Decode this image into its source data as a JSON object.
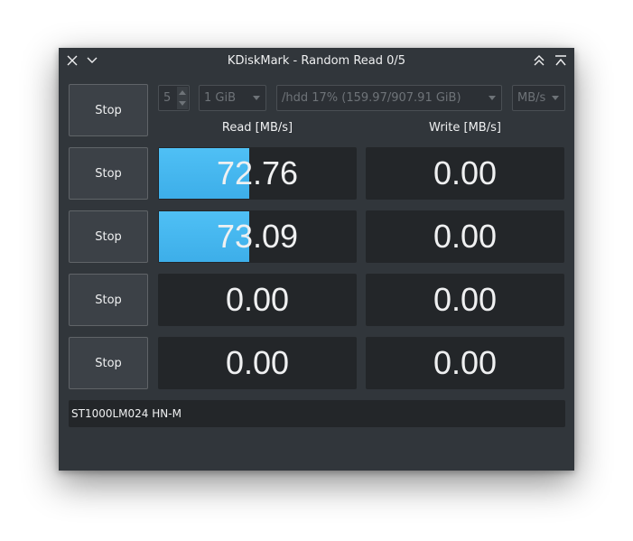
{
  "window": {
    "title": "KDiskMark - Random Read 0/5"
  },
  "titlebar": {
    "close_icon": "close-icon",
    "menu_icon": "chevron-down-icon",
    "keep_above_icon": "double-chevron-up-icon",
    "maximize_icon": "maximize-icon"
  },
  "controls": {
    "loops": "5",
    "file_size": "1 GiB",
    "target": "/hdd 17% (159.97/907.91 GiB)",
    "unit": "MB/s"
  },
  "headers": {
    "read": "Read [MB/s]",
    "write": "Write [MB/s]"
  },
  "rows": [
    {
      "button": "Stop",
      "read": "",
      "write": "",
      "read_progress": 0,
      "write_progress": 0
    },
    {
      "button": "Stop",
      "read": "72.76",
      "write": "0.00",
      "read_progress": 0.46,
      "write_progress": 0
    },
    {
      "button": "Stop",
      "read": "73.09",
      "write": "0.00",
      "read_progress": 0.46,
      "write_progress": 0
    },
    {
      "button": "Stop",
      "read": "0.00",
      "write": "0.00",
      "read_progress": 0,
      "write_progress": 0
    },
    {
      "button": "Stop",
      "read": "0.00",
      "write": "0.00",
      "read_progress": 0,
      "write_progress": 0
    }
  ],
  "device": "ST1000LM024 HN-M",
  "colors": {
    "accent": "#3daee9",
    "window_bg": "#31363b",
    "cell_bg": "#232629",
    "text": "#eff0f1"
  }
}
